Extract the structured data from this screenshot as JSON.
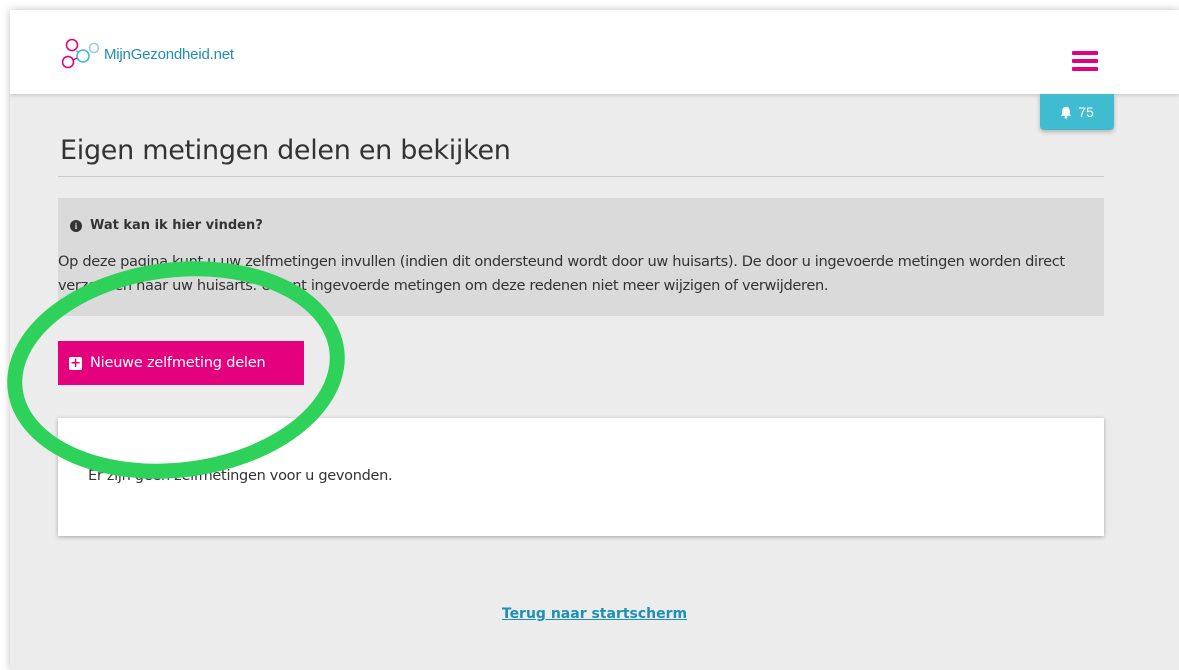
{
  "header": {
    "logo_text": "MijnGezondheid.net",
    "notification_count": "75",
    "brand_color": "#e5007e",
    "accent_color": "#3fbcd0"
  },
  "page": {
    "title": "Eigen metingen delen en bekijken"
  },
  "info": {
    "heading": "Wat kan ik hier vinden?",
    "text": "Op deze pagina kunt u uw zelfmetingen invullen (indien dit ondersteund wordt door uw huisarts). De door u ingevoerde metingen worden direct verzonden naar uw huisarts. U kunt ingevoerde metingen om deze redenen niet meer wijzigen of verwijderen."
  },
  "actions": {
    "new_measurement_label": "Nieuwe zelfmeting delen"
  },
  "results": {
    "empty_message": "Er zijn geen zelfmetingen voor u gevonden."
  },
  "footer": {
    "back_link": "Terug naar startscherm"
  },
  "annotation": {
    "highlight_color": "#2ed15a"
  }
}
